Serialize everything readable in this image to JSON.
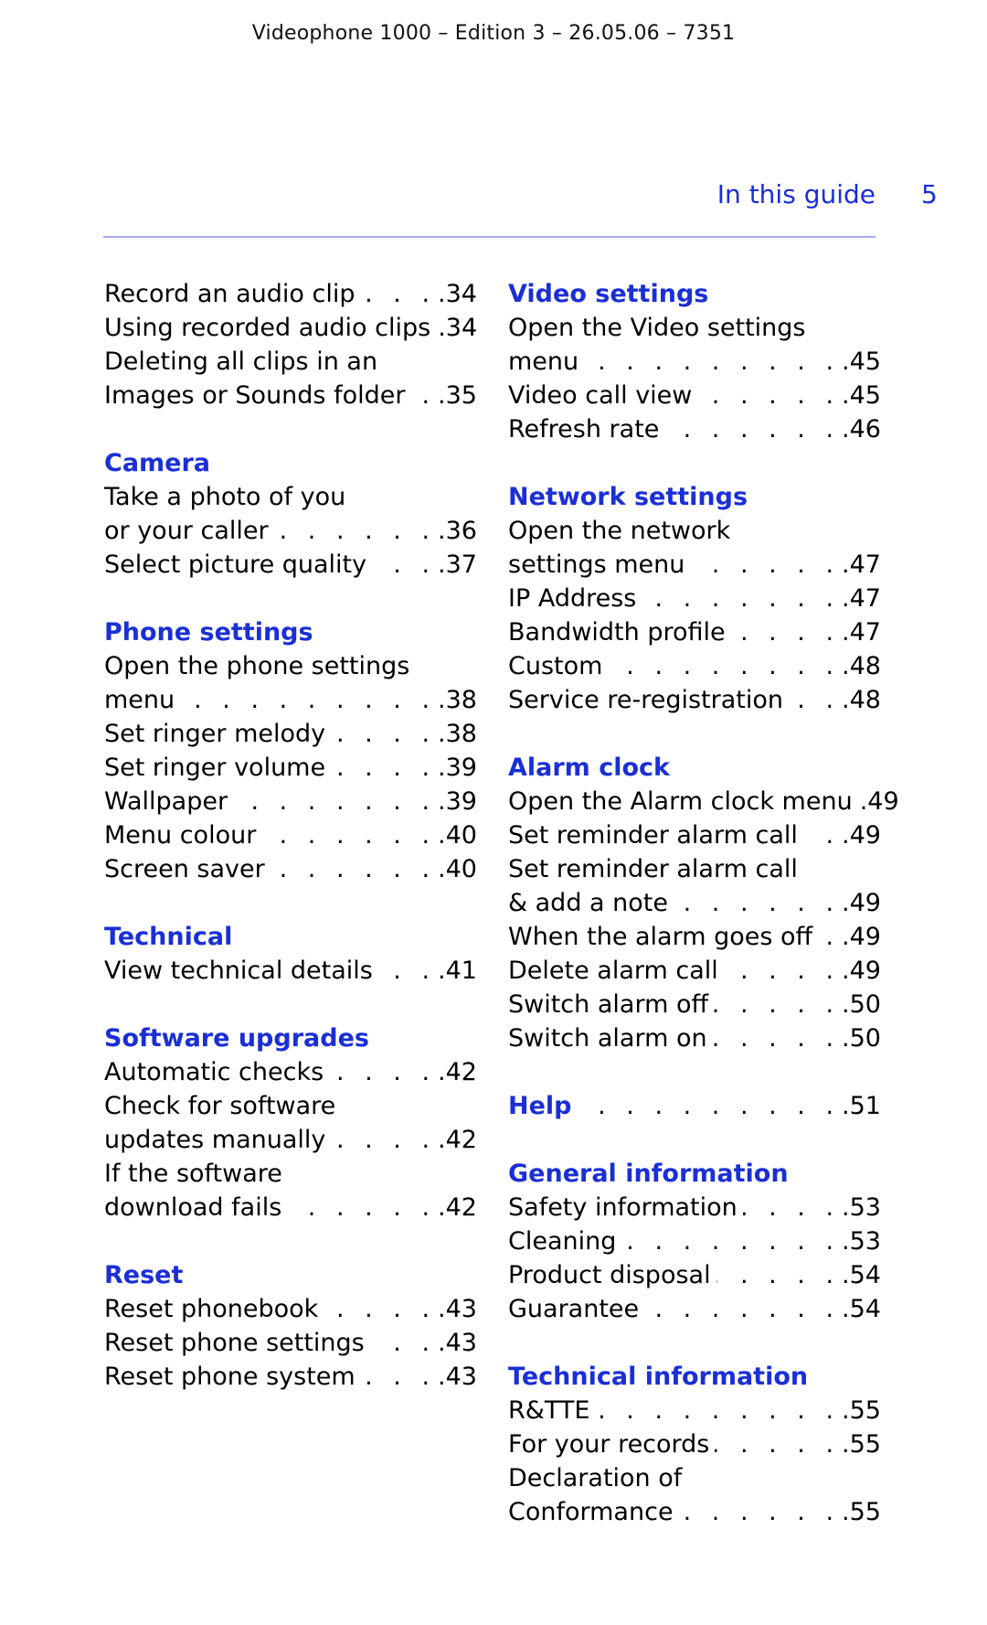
{
  "document": {
    "header": "Videophone 1000 – Edition 3 – 26.05.06 – 7351",
    "section_title": "In this guide",
    "page_number": "5",
    "colors": {
      "accent": "#1a2fd6",
      "rule": "#a7aaf5",
      "text": "#000000"
    }
  },
  "left_column": [
    {
      "heading": null,
      "entries": [
        {
          "lines": [
            "Record an audio clip"
          ],
          "page": ".34"
        },
        {
          "lines": [
            "Using recorded audio clips"
          ],
          "page": ".34"
        },
        {
          "lines": [
            "Deleting all clips in an",
            "Images or Sounds folder"
          ],
          "page": ".35"
        }
      ]
    },
    {
      "heading": "Camera",
      "entries": [
        {
          "lines": [
            "Take a photo of you",
            "or your caller"
          ],
          "page": ".36"
        },
        {
          "lines": [
            "Select picture quality"
          ],
          "page": ".37"
        }
      ]
    },
    {
      "heading": "Phone settings",
      "entries": [
        {
          "lines": [
            "Open the phone settings",
            "menu"
          ],
          "page": ".38"
        },
        {
          "lines": [
            "Set ringer melody"
          ],
          "page": ".38"
        },
        {
          "lines": [
            "Set ringer volume"
          ],
          "page": ".39"
        },
        {
          "lines": [
            "Wallpaper"
          ],
          "page": ".39"
        },
        {
          "lines": [
            "Menu colour"
          ],
          "page": ".40"
        },
        {
          "lines": [
            "Screen saver"
          ],
          "page": ".40"
        }
      ]
    },
    {
      "heading": "Technical",
      "entries": [
        {
          "lines": [
            "View technical details"
          ],
          "page": ".41"
        }
      ]
    },
    {
      "heading": "Software upgrades",
      "entries": [
        {
          "lines": [
            "Automatic checks"
          ],
          "page": ".42"
        },
        {
          "lines": [
            "Check for software",
            "updates manually"
          ],
          "page": ".42"
        },
        {
          "lines": [
            "If the software",
            "download fails"
          ],
          "page": ".42"
        }
      ]
    },
    {
      "heading": "Reset",
      "entries": [
        {
          "lines": [
            "Reset phonebook"
          ],
          "page": ".43"
        },
        {
          "lines": [
            "Reset phone settings"
          ],
          "page": ".43"
        },
        {
          "lines": [
            "Reset phone system"
          ],
          "page": ".43"
        }
      ]
    }
  ],
  "right_column": [
    {
      "heading": "Video settings",
      "entries": [
        {
          "lines": [
            "Open the Video settings",
            "menu"
          ],
          "page": ".45"
        },
        {
          "lines": [
            "Video call view"
          ],
          "page": ".45"
        },
        {
          "lines": [
            "Refresh rate"
          ],
          "page": ".46"
        }
      ]
    },
    {
      "heading": "Network settings",
      "entries": [
        {
          "lines": [
            "Open the network",
            "settings menu"
          ],
          "page": ".47"
        },
        {
          "lines": [
            "IP Address"
          ],
          "page": ".47"
        },
        {
          "lines": [
            "Bandwidth profile"
          ],
          "page": ".47"
        },
        {
          "lines": [
            "Custom"
          ],
          "page": ".48"
        },
        {
          "lines": [
            "Service re-registration"
          ],
          "page": ".48"
        }
      ]
    },
    {
      "heading": "Alarm clock",
      "entries": [
        {
          "lines": [
            "Open the Alarm clock menu"
          ],
          "page": ".49"
        },
        {
          "lines": [
            "Set reminder alarm call"
          ],
          "page": ".49"
        },
        {
          "lines": [
            "Set reminder alarm call",
            "& add a note"
          ],
          "page": ".49"
        },
        {
          "lines": [
            "When the alarm goes off"
          ],
          "page": ".49"
        },
        {
          "lines": [
            "Delete alarm call"
          ],
          "page": ".49"
        },
        {
          "lines": [
            "Switch alarm off"
          ],
          "page": ".50"
        },
        {
          "lines": [
            "Switch alarm on"
          ],
          "page": ".50"
        }
      ]
    },
    {
      "heading_entry": {
        "title": "Help",
        "page": ".51"
      },
      "entries": []
    },
    {
      "heading": "General information",
      "entries": [
        {
          "lines": [
            "Safety information"
          ],
          "page": ".53"
        },
        {
          "lines": [
            "Cleaning"
          ],
          "page": ".53"
        },
        {
          "lines": [
            "Product disposal"
          ],
          "page": ".54"
        },
        {
          "lines": [
            "Guarantee"
          ],
          "page": ".54"
        }
      ]
    },
    {
      "heading": "Technical information",
      "entries": [
        {
          "lines": [
            "R&TTE"
          ],
          "page": ".55"
        },
        {
          "lines": [
            "For your records"
          ],
          "page": ".55"
        },
        {
          "lines": [
            "Declaration of",
            "Conformance"
          ],
          "page": ".55"
        }
      ]
    }
  ]
}
